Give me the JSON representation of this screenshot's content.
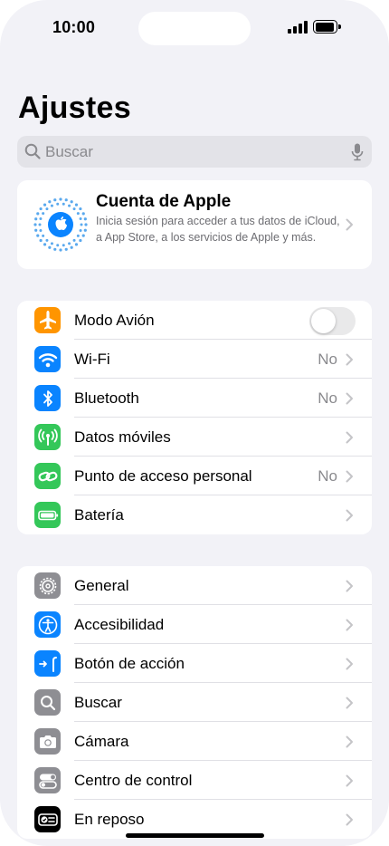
{
  "status_bar": {
    "time": "10:00"
  },
  "title": "Ajustes",
  "search": {
    "placeholder": "Buscar"
  },
  "account": {
    "title": "Cuenta de Apple",
    "subtitle": "Inicia sesión para acceder a tus datos de iCloud, a App Store, a los servicios de Apple y más."
  },
  "connectivity": [
    {
      "label": "Modo Avión",
      "icon": "airplane-icon",
      "color": "#ff9500",
      "control": "toggle",
      "on": false
    },
    {
      "label": "Wi-Fi",
      "icon": "wifi-icon",
      "color": "#0a84ff",
      "value": "No"
    },
    {
      "label": "Bluetooth",
      "icon": "bluetooth-icon",
      "color": "#0a84ff",
      "value": "No"
    },
    {
      "label": "Datos móviles",
      "icon": "antenna-icon",
      "color": "#34c759"
    },
    {
      "label": "Punto de acceso personal",
      "icon": "hotspot-link-icon",
      "color": "#34c759",
      "value": "No"
    },
    {
      "label": "Batería",
      "icon": "battery-icon",
      "color": "#34c759"
    }
  ],
  "general": [
    {
      "label": "General",
      "icon": "gear-icon",
      "color": "#8e8e93"
    },
    {
      "label": "Accesibilidad",
      "icon": "accessibility-icon",
      "color": "#0a84ff"
    },
    {
      "label": "Botón de acción",
      "icon": "action-button-icon",
      "color": "#0a84ff"
    },
    {
      "label": "Buscar",
      "icon": "search-icon",
      "color": "#8e8e93"
    },
    {
      "label": "Cámara",
      "icon": "camera-icon",
      "color": "#8e8e93"
    },
    {
      "label": "Centro de control",
      "icon": "toggles-icon",
      "color": "#8e8e93"
    },
    {
      "label": "En reposo",
      "icon": "standby-icon",
      "color": "#000000"
    }
  ]
}
